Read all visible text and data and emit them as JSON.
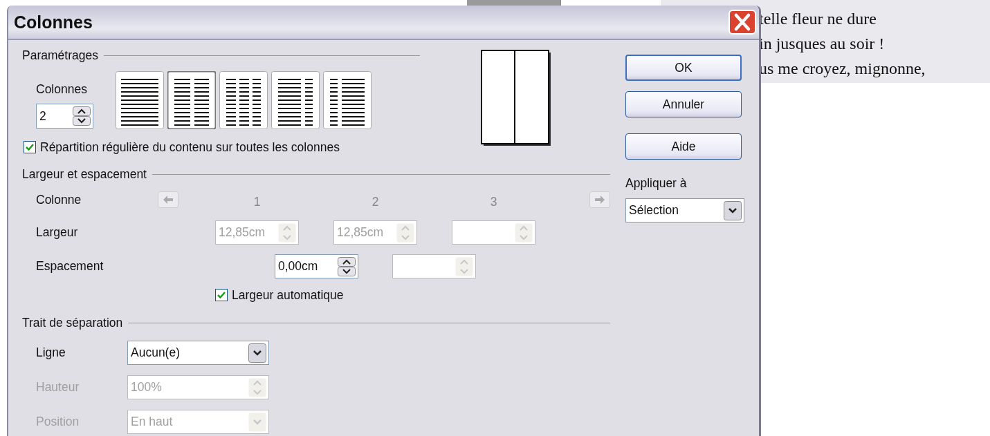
{
  "window": {
    "title": "Colonnes"
  },
  "settings": {
    "legend": "Paramétrages",
    "columns_label": "Colonnes",
    "columns_value": "2",
    "presets": [
      {
        "kind": "single",
        "selected": false
      },
      {
        "kind": "double",
        "selected": true
      },
      {
        "kind": "triple",
        "selected": false
      },
      {
        "kind": "left-wide",
        "selected": false
      },
      {
        "kind": "right-wide",
        "selected": false
      }
    ],
    "even_distribution": {
      "label": "Répartition régulière du contenu sur toutes les colonnes",
      "checked": true
    }
  },
  "width_spacing": {
    "legend": "Largeur et espacement",
    "column_label": "Colonne",
    "column_numbers": [
      "1",
      "2",
      "3"
    ],
    "width_label": "Largeur",
    "widths": [
      {
        "value": "12,85cm",
        "disabled": true
      },
      {
        "value": "12,85cm",
        "disabled": true
      },
      {
        "disabled": true
      }
    ],
    "spacing_label": "Espacement",
    "spacings": [
      {
        "value": "0,00cm",
        "disabled": false
      },
      {
        "disabled": true
      }
    ],
    "auto_width": {
      "label": "Largeur automatique",
      "checked": true
    }
  },
  "separator": {
    "legend": "Trait de séparation",
    "rows": [
      {
        "label": "Ligne",
        "value": "Aucun(e)",
        "kind": "dropdown",
        "disabled": false
      },
      {
        "label": "Hauteur",
        "value": "100%",
        "kind": "spinner",
        "disabled": true
      },
      {
        "label": "Position",
        "value": "En haut",
        "kind": "dropdown",
        "disabled": true
      }
    ]
  },
  "buttons": [
    "OK",
    "Annuler",
    "Aide"
  ],
  "apply_to": {
    "label": "Appliquer à",
    "value": "Sélection"
  },
  "document_lines": [
    "telle fleur ne dure",
    "in jusques au soir !",
    "us me croyez, mignonne,"
  ]
}
